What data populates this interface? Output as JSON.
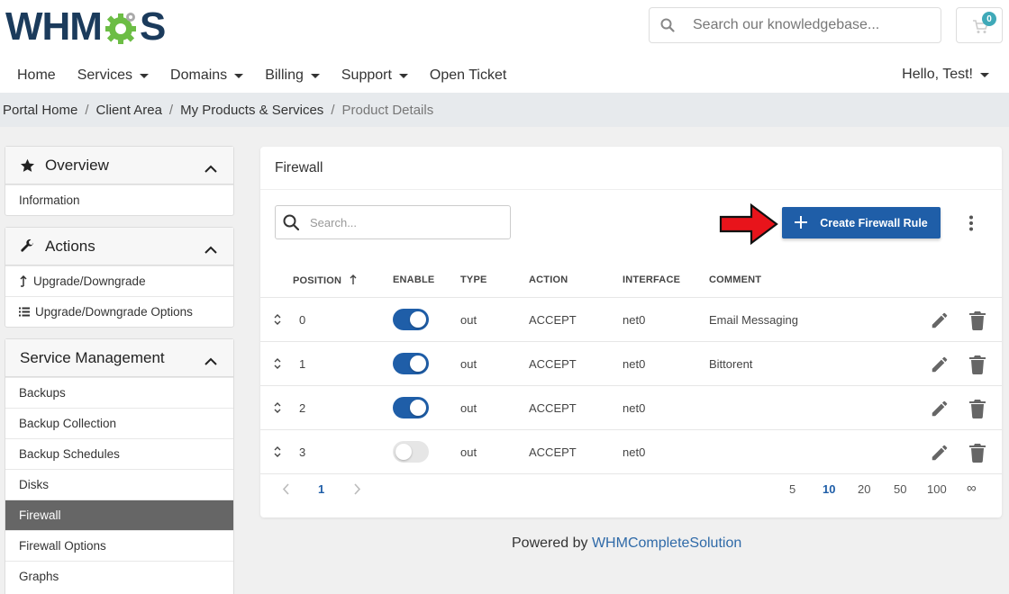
{
  "header": {
    "logo_text_left": "WHM",
    "logo_text_right": "S",
    "search_placeholder": "Search our knowledgebase...",
    "cart_count": "0",
    "greeting": "Hello, Test!"
  },
  "nav": {
    "items": [
      {
        "label": "Home",
        "dropdown": false
      },
      {
        "label": "Services",
        "dropdown": true
      },
      {
        "label": "Domains",
        "dropdown": true
      },
      {
        "label": "Billing",
        "dropdown": true
      },
      {
        "label": "Support",
        "dropdown": true
      },
      {
        "label": "Open Ticket",
        "dropdown": false
      }
    ]
  },
  "breadcrumb": {
    "items": [
      "Portal Home",
      "Client Area",
      "My Products & Services"
    ],
    "current": "Product Details"
  },
  "sidebar": {
    "overview": {
      "title": "Overview",
      "items": [
        "Information"
      ]
    },
    "actions": {
      "title": "Actions",
      "items": [
        "Upgrade/Downgrade",
        "Upgrade/Downgrade Options"
      ]
    },
    "service_management": {
      "title": "Service Management",
      "items": [
        "Backups",
        "Backup Collection",
        "Backup Schedules",
        "Disks",
        "Firewall",
        "Firewall Options",
        "Graphs"
      ],
      "active": "Firewall"
    }
  },
  "firewall": {
    "title": "Firewall",
    "search_placeholder": "Search...",
    "create_label": "Create Firewall Rule",
    "columns": {
      "position": "POSITION",
      "enable": "ENABLE",
      "type": "TYPE",
      "action": "ACTION",
      "interface": "INTERFACE",
      "comment": "COMMENT"
    },
    "rows": [
      {
        "position": "0",
        "enabled": true,
        "type": "out",
        "action": "ACCEPT",
        "interface": "net0",
        "comment": "Email Messaging"
      },
      {
        "position": "1",
        "enabled": true,
        "type": "out",
        "action": "ACCEPT",
        "interface": "net0",
        "comment": "Bittorent"
      },
      {
        "position": "2",
        "enabled": true,
        "type": "out",
        "action": "ACCEPT",
        "interface": "net0",
        "comment": ""
      },
      {
        "position": "3",
        "enabled": false,
        "type": "out",
        "action": "ACCEPT",
        "interface": "net0",
        "comment": ""
      }
    ],
    "pagination": {
      "current_page": "1",
      "page_sizes": [
        "5",
        "10",
        "20",
        "50",
        "100",
        "∞"
      ],
      "active_page_size": "10"
    }
  },
  "footer": {
    "powered_prefix": "Powered by",
    "powered_link": "WHMCompleteSolution"
  },
  "colors": {
    "primary": "#1f5ea8",
    "logo_green": "#6cbd45",
    "logo_navy": "#1b3b5c",
    "active_sidebar": "#666666",
    "arrow_red": "#e8141b"
  }
}
